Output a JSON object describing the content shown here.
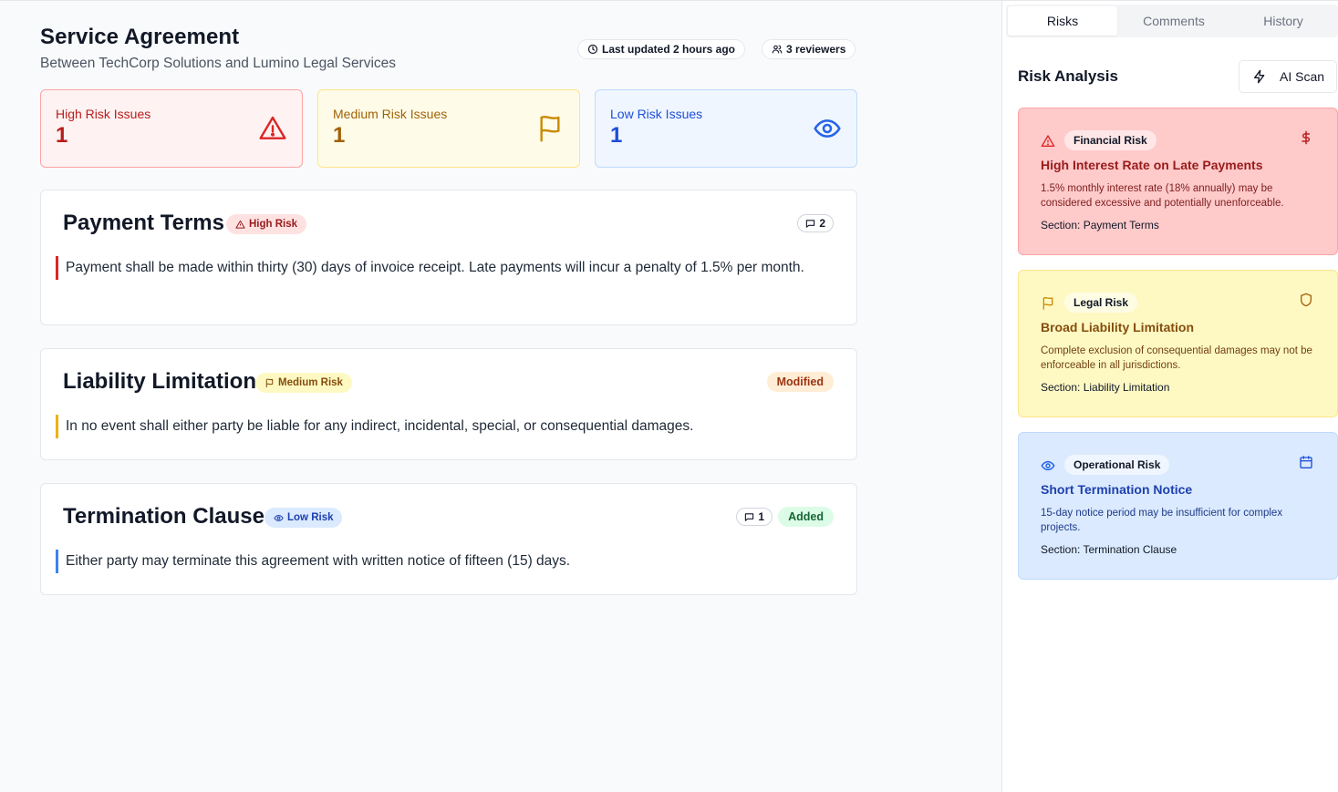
{
  "header": {
    "title": "Service Agreement",
    "subtitle": "Between TechCorp Solutions and Lumino Legal Services",
    "last_updated": "Last updated 2 hours ago",
    "reviewers": "3 reviewers"
  },
  "stats": {
    "high": {
      "label": "High Risk Issues",
      "count": "1"
    },
    "medium": {
      "label": "Medium Risk Issues",
      "count": "1"
    },
    "low": {
      "label": "Low Risk Issues",
      "count": "1"
    }
  },
  "clauses": [
    {
      "title": "Payment Terms",
      "risk": "High Risk",
      "comments": "2",
      "text": "Payment shall be made within thirty (30) days of invoice receipt. Late payments will incur a penalty of 1.5% per month."
    },
    {
      "title": "Liability Limitation",
      "risk": "Medium Risk",
      "status": "Modified",
      "text": "In no event shall either party be liable for any indirect, incidental, special, or consequential damages."
    },
    {
      "title": "Termination Clause",
      "risk": "Low Risk",
      "comments": "1",
      "status": "Added",
      "text": "Either party may terminate this agreement with written notice of fifteen (15) days."
    }
  ],
  "sidebar": {
    "tabs": [
      "Risks",
      "Comments",
      "History"
    ],
    "heading": "Risk Analysis",
    "ai_scan_label": "AI Scan",
    "risks": [
      {
        "category": "Financial Risk",
        "title": "High Interest Rate on Late Payments",
        "description": "1.5% monthly interest rate (18% annually) may be considered excessive and potentially unenforceable.",
        "section": "Section: Payment Terms"
      },
      {
        "category": "Legal Risk",
        "title": "Broad Liability Limitation",
        "description": "Complete exclusion of consequential damages may not be enforceable in all jurisdictions.",
        "section": "Section: Liability Limitation"
      },
      {
        "category": "Operational Risk",
        "title": "Short Termination Notice",
        "description": "15-day notice period may be insufficient for complex projects.",
        "section": "Section: Termination Clause"
      }
    ]
  },
  "colors": {
    "high": "#dc2626",
    "medium": "#ca8a04",
    "low": "#2563eb"
  },
  "icons": [
    "clock-icon",
    "users-icon",
    "alert-triangle-icon",
    "flag-icon",
    "eye-icon",
    "message-icon",
    "zap-icon",
    "dollar-icon",
    "shield-icon",
    "calendar-icon"
  ]
}
